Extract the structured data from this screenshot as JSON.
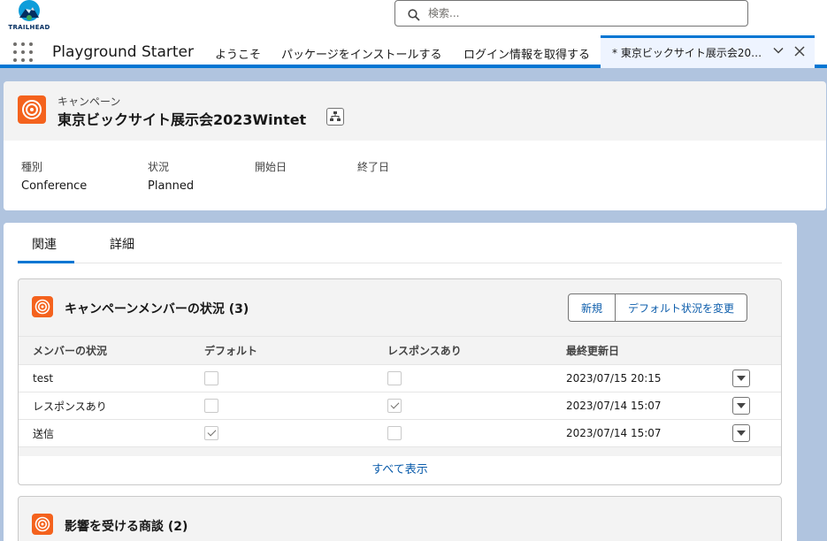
{
  "brand": {
    "name": "TRAILHEAD"
  },
  "search": {
    "placeholder": "検索..."
  },
  "nav": {
    "app_name": "Playground Starter",
    "items": [
      "ようこそ",
      "パッケージをインストールする",
      "ログイン情報を取得する"
    ],
    "active_tab": "* 東京ビックサイト展示会2023Wintet"
  },
  "record": {
    "object_type": "キャンペーン",
    "title": "東京ビックサイト展示会2023Wintet",
    "fields": [
      {
        "label": "種別",
        "value": "Conference"
      },
      {
        "label": "状況",
        "value": "Planned"
      },
      {
        "label": "開始日",
        "value": ""
      },
      {
        "label": "終了日",
        "value": ""
      }
    ]
  },
  "tabs": {
    "related": "関連",
    "details": "詳細"
  },
  "member_status": {
    "title": "キャンペーンメンバーの状況 (3)",
    "buttons": {
      "new": "新規",
      "change_default": "デフォルト状況を変更"
    },
    "columns": [
      "メンバーの状況",
      "デフォルト",
      "レスポンスあり",
      "最終更新日"
    ],
    "rows": [
      {
        "status": "test",
        "default": false,
        "responded": false,
        "modified": "2023/07/15 20:15"
      },
      {
        "status": "レスポンスあり",
        "default": false,
        "responded": true,
        "modified": "2023/07/14 15:07"
      },
      {
        "status": "送信",
        "default": true,
        "responded": false,
        "modified": "2023/07/14 15:07"
      }
    ],
    "view_all": "すべて表示"
  },
  "opportunities": {
    "title": "影響を受ける商談 (2)"
  },
  "colors": {
    "accent": "#0176d3",
    "campaign_icon": "#f4621d",
    "link": "#0b5cab"
  }
}
